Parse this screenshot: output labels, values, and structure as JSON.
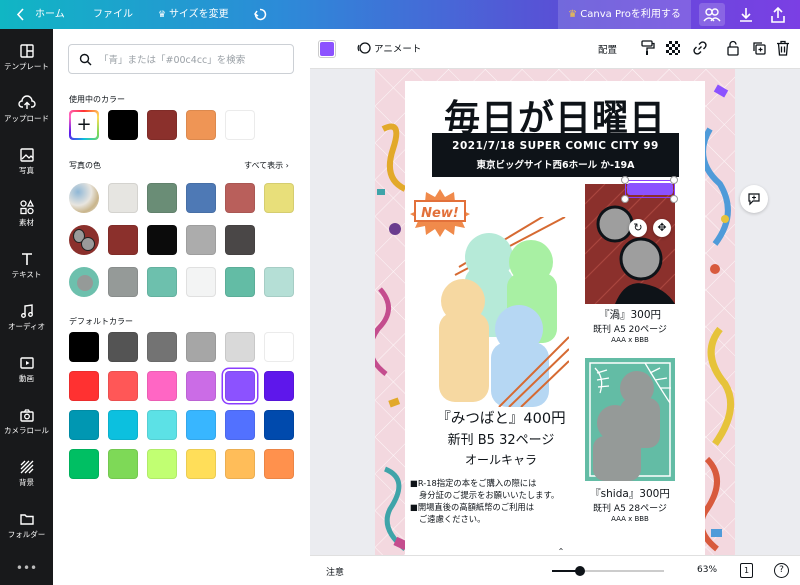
{
  "topbar": {
    "home": "ホーム",
    "file": "ファイル",
    "resize": "サイズを変更",
    "pro": "Canva Proを利用する"
  },
  "nav": [
    {
      "label": "テンプレート"
    },
    {
      "label": "アップロード"
    },
    {
      "label": "写真"
    },
    {
      "label": "素材"
    },
    {
      "label": "テキスト"
    },
    {
      "label": "オーディオ"
    },
    {
      "label": "動画"
    },
    {
      "label": "カメラロール"
    },
    {
      "label": "背景"
    },
    {
      "label": "フォルダー"
    }
  ],
  "panel": {
    "search_placeholder": "「青」または「#00c4cc」を検索",
    "in_use_title": "使用中のカラー",
    "in_use": [
      "#000000",
      "#8b302c",
      "#ef9555",
      "#ffffff"
    ],
    "photo_title": "写真の色",
    "see_all": "すべて表示",
    "photo_rows": [
      [
        "#e6e5e1",
        "#6a8d76",
        "#4e79b5",
        "#b95f5b",
        "#e8df7a"
      ],
      [
        "#8b302c",
        "#0b0b0b",
        "#acacac",
        "#4a4747"
      ],
      [
        "#959a98",
        "#6dc0ad",
        "#f3f4f4",
        "#63bca5",
        "#b5dfd6"
      ]
    ],
    "default_title": "デフォルトカラー",
    "default_rows": [
      [
        "#000000",
        "#545454",
        "#737373",
        "#a6a6a6",
        "#d9d9d9",
        "#ffffff"
      ],
      [
        "#ff3131",
        "#ff5757",
        "#ff66c4",
        "#cb6ce6",
        "#8c52ff",
        "#5e17eb"
      ],
      [
        "#0097b2",
        "#0cc0df",
        "#5ce1e6",
        "#38b6ff",
        "#5271ff",
        "#004aad"
      ],
      [
        "#00bf63",
        "#7ed957",
        "#c1ff72",
        "#ffde59",
        "#ffbd59",
        "#ff914d"
      ]
    ]
  },
  "ctx": {
    "animate": "アニメート",
    "position": "配置",
    "fill_color": "#8c52ff"
  },
  "poster": {
    "title": "毎日が日曜日",
    "event_line1": "2021/7/18 SUPER COMIC CITY 99",
    "event_line2": "東京ビッグサイト西6ホール か-19A",
    "new_badge": "New!",
    "main_title": "『みつばと』400円",
    "main_sub": "新刊 B5 32ページ",
    "main_cast": "オールキャラ",
    "note1a": "■R-18指定の本をご購入の際には",
    "note1b": "身分証のご提示をお願いいたします。",
    "note2a": "■開場直後の高額紙幣のご利用は",
    "note2b": "ご遠慮ください。",
    "book1_title": "『渦』300円",
    "book1_sub": "既刊 A5 20ページ",
    "book1_pair": "AAA x BBB",
    "book2_title": "『shida』300円",
    "book2_sub": "既刊 A5 28ページ",
    "book2_pair": "AAA x BBB"
  },
  "bottombar": {
    "notes": "注意",
    "zoom": "63%",
    "page": "1",
    "help": "?",
    "zoom_level": 0.63
  }
}
